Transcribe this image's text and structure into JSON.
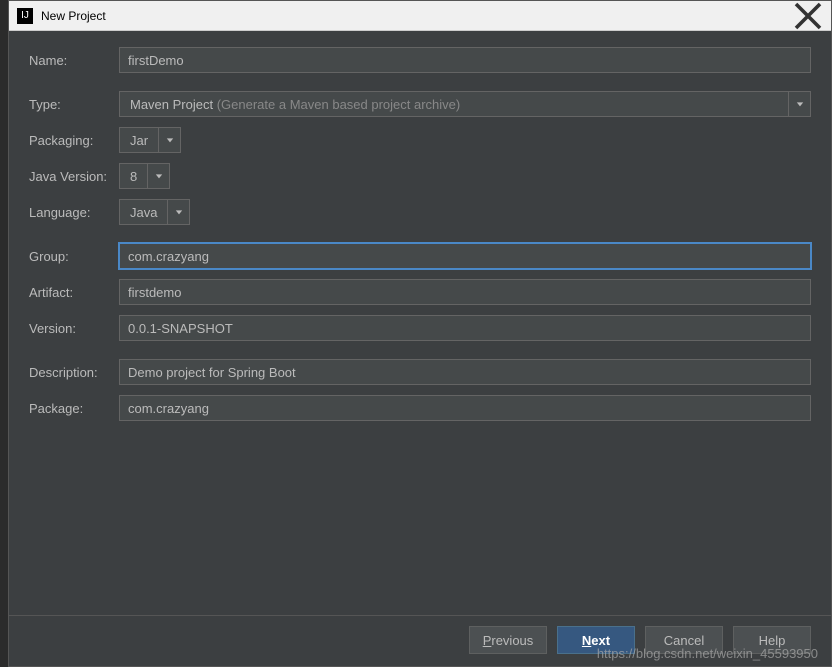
{
  "titlebar": {
    "title": "New Project",
    "icon_label": "IJ"
  },
  "form": {
    "name_label": "Name:",
    "name_value": "firstDemo",
    "type_label": "Type:",
    "type_value": "Maven Project",
    "type_hint": "(Generate a Maven based project archive)",
    "packaging_label": "Packaging:",
    "packaging_value": "Jar",
    "java_version_label": "Java Version:",
    "java_version_value": "8",
    "language_label": "Language:",
    "language_value": "Java",
    "group_label": "Group:",
    "group_value": "com.crazyang",
    "artifact_label": "Artifact:",
    "artifact_value": "firstdemo",
    "version_label": "Version:",
    "version_value": "0.0.1-SNAPSHOT",
    "description_label": "Description:",
    "description_value": "Demo project for Spring Boot",
    "package_label": "Package:",
    "package_value": "com.crazyang"
  },
  "footer": {
    "previous": "Previous",
    "next": "Next",
    "cancel": "Cancel",
    "help": "Help"
  },
  "watermark": "https://blog.csdn.net/weixin_45593950"
}
